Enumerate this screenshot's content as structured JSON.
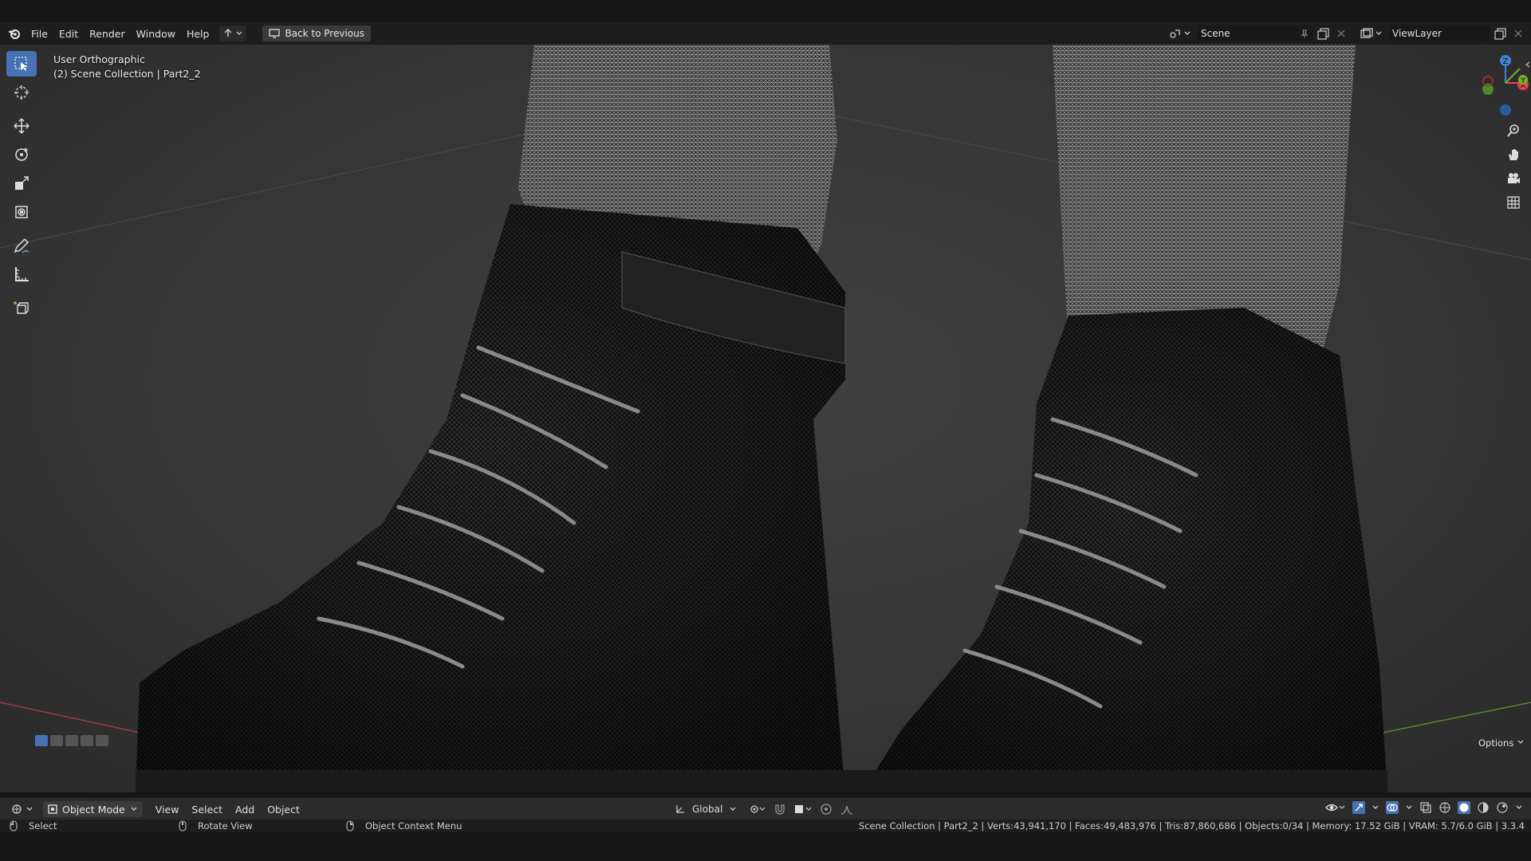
{
  "menu": {
    "file": "File",
    "edit": "Edit",
    "render": "Render",
    "window": "Window",
    "help": "Help",
    "back_button": "Back to Previous"
  },
  "scene": {
    "name": "Scene",
    "view_layer": "ViewLayer"
  },
  "viewport": {
    "view_name": "User Orthographic",
    "collection_info": "(2) Scene Collection | Part2_2",
    "options_label": "Options"
  },
  "header": {
    "mode": "Object Mode",
    "view": "View",
    "select": "Select",
    "add": "Add",
    "object": "Object",
    "transform_orientation": "Global"
  },
  "status": {
    "select": "Select",
    "rotate_view": "Rotate View",
    "context_menu": "Object Context Menu",
    "stats": "Scene Collection | Part2_2 | Verts:43,941,170 | Faces:49,483,976 | Tris:87,860,686 | Objects:0/34 | Memory: 17.52 GiB | VRAM: 5.7/6.0 GiB | 3.3.4"
  },
  "gizmo": {
    "x_label": "X",
    "y_label": "Y",
    "z_label": "Z"
  },
  "colors": {
    "accent": "#4772b3",
    "axis_x": "#e24450",
    "axis_y": "#74b42a",
    "axis_z": "#3b84d8"
  }
}
